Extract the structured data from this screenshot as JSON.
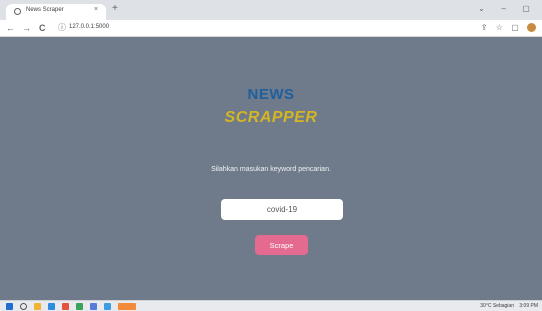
{
  "browser": {
    "tab_title": "News Scraper",
    "tab_close": "×",
    "new_tab": "+",
    "url": "127.0.0.1:5000",
    "back": "←",
    "forward": "→",
    "reload": "C",
    "info": "ⓘ",
    "window_controls": [
      "⌄",
      "–",
      "▢"
    ],
    "toolbar_icons": [
      "⇪",
      "☆",
      "▢"
    ]
  },
  "page": {
    "title_line1": "NEWS",
    "title_line2": "SCRAPPER",
    "prompt": "Silahkan masukan keyword pencarian.",
    "input_value": "covid-19",
    "submit_label": "Scrape"
  },
  "taskbar": {
    "weather": "30°C  Sebagian",
    "time": "3:09 PM"
  },
  "colors": {
    "background": "#6f7b8b",
    "news": "#1f5f9e",
    "scrapper": "#d4b623",
    "button": "#e46b8f"
  }
}
